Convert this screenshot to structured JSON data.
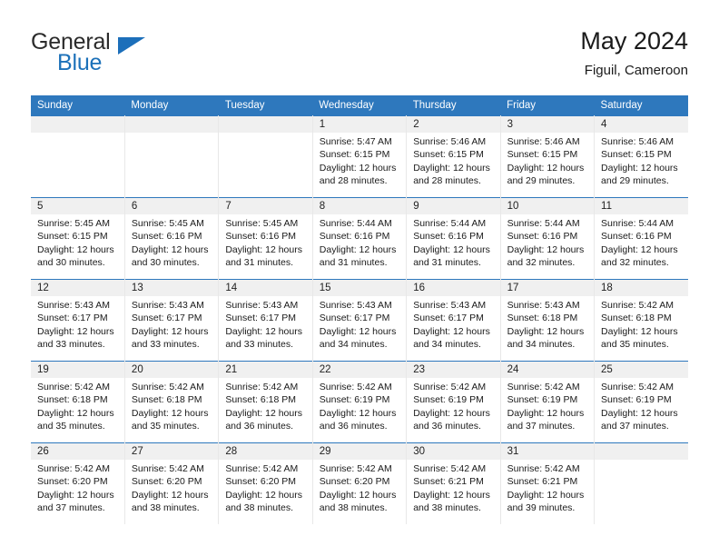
{
  "brand": {
    "word1": "General",
    "word2": "Blue",
    "accent_color": "#1c6fba"
  },
  "header": {
    "title": "May 2024",
    "location": "Figuil, Cameroon"
  },
  "calendar": {
    "header_bg": "#2e78bd",
    "daynum_bg": "#f0f0f0",
    "weekdays": [
      "Sunday",
      "Monday",
      "Tuesday",
      "Wednesday",
      "Thursday",
      "Friday",
      "Saturday"
    ],
    "weeks": [
      [
        {
          "day": "",
          "empty": true
        },
        {
          "day": "",
          "empty": true
        },
        {
          "day": "",
          "empty": true
        },
        {
          "day": "1",
          "sunrise": "Sunrise: 5:47 AM",
          "sunset": "Sunset: 6:15 PM",
          "daylight1": "Daylight: 12 hours",
          "daylight2": "and 28 minutes."
        },
        {
          "day": "2",
          "sunrise": "Sunrise: 5:46 AM",
          "sunset": "Sunset: 6:15 PM",
          "daylight1": "Daylight: 12 hours",
          "daylight2": "and 28 minutes."
        },
        {
          "day": "3",
          "sunrise": "Sunrise: 5:46 AM",
          "sunset": "Sunset: 6:15 PM",
          "daylight1": "Daylight: 12 hours",
          "daylight2": "and 29 minutes."
        },
        {
          "day": "4",
          "sunrise": "Sunrise: 5:46 AM",
          "sunset": "Sunset: 6:15 PM",
          "daylight1": "Daylight: 12 hours",
          "daylight2": "and 29 minutes."
        }
      ],
      [
        {
          "day": "5",
          "sunrise": "Sunrise: 5:45 AM",
          "sunset": "Sunset: 6:15 PM",
          "daylight1": "Daylight: 12 hours",
          "daylight2": "and 30 minutes."
        },
        {
          "day": "6",
          "sunrise": "Sunrise: 5:45 AM",
          "sunset": "Sunset: 6:16 PM",
          "daylight1": "Daylight: 12 hours",
          "daylight2": "and 30 minutes."
        },
        {
          "day": "7",
          "sunrise": "Sunrise: 5:45 AM",
          "sunset": "Sunset: 6:16 PM",
          "daylight1": "Daylight: 12 hours",
          "daylight2": "and 31 minutes."
        },
        {
          "day": "8",
          "sunrise": "Sunrise: 5:44 AM",
          "sunset": "Sunset: 6:16 PM",
          "daylight1": "Daylight: 12 hours",
          "daylight2": "and 31 minutes."
        },
        {
          "day": "9",
          "sunrise": "Sunrise: 5:44 AM",
          "sunset": "Sunset: 6:16 PM",
          "daylight1": "Daylight: 12 hours",
          "daylight2": "and 31 minutes."
        },
        {
          "day": "10",
          "sunrise": "Sunrise: 5:44 AM",
          "sunset": "Sunset: 6:16 PM",
          "daylight1": "Daylight: 12 hours",
          "daylight2": "and 32 minutes."
        },
        {
          "day": "11",
          "sunrise": "Sunrise: 5:44 AM",
          "sunset": "Sunset: 6:16 PM",
          "daylight1": "Daylight: 12 hours",
          "daylight2": "and 32 minutes."
        }
      ],
      [
        {
          "day": "12",
          "sunrise": "Sunrise: 5:43 AM",
          "sunset": "Sunset: 6:17 PM",
          "daylight1": "Daylight: 12 hours",
          "daylight2": "and 33 minutes."
        },
        {
          "day": "13",
          "sunrise": "Sunrise: 5:43 AM",
          "sunset": "Sunset: 6:17 PM",
          "daylight1": "Daylight: 12 hours",
          "daylight2": "and 33 minutes."
        },
        {
          "day": "14",
          "sunrise": "Sunrise: 5:43 AM",
          "sunset": "Sunset: 6:17 PM",
          "daylight1": "Daylight: 12 hours",
          "daylight2": "and 33 minutes."
        },
        {
          "day": "15",
          "sunrise": "Sunrise: 5:43 AM",
          "sunset": "Sunset: 6:17 PM",
          "daylight1": "Daylight: 12 hours",
          "daylight2": "and 34 minutes."
        },
        {
          "day": "16",
          "sunrise": "Sunrise: 5:43 AM",
          "sunset": "Sunset: 6:17 PM",
          "daylight1": "Daylight: 12 hours",
          "daylight2": "and 34 minutes."
        },
        {
          "day": "17",
          "sunrise": "Sunrise: 5:43 AM",
          "sunset": "Sunset: 6:18 PM",
          "daylight1": "Daylight: 12 hours",
          "daylight2": "and 34 minutes."
        },
        {
          "day": "18",
          "sunrise": "Sunrise: 5:42 AM",
          "sunset": "Sunset: 6:18 PM",
          "daylight1": "Daylight: 12 hours",
          "daylight2": "and 35 minutes."
        }
      ],
      [
        {
          "day": "19",
          "sunrise": "Sunrise: 5:42 AM",
          "sunset": "Sunset: 6:18 PM",
          "daylight1": "Daylight: 12 hours",
          "daylight2": "and 35 minutes."
        },
        {
          "day": "20",
          "sunrise": "Sunrise: 5:42 AM",
          "sunset": "Sunset: 6:18 PM",
          "daylight1": "Daylight: 12 hours",
          "daylight2": "and 35 minutes."
        },
        {
          "day": "21",
          "sunrise": "Sunrise: 5:42 AM",
          "sunset": "Sunset: 6:18 PM",
          "daylight1": "Daylight: 12 hours",
          "daylight2": "and 36 minutes."
        },
        {
          "day": "22",
          "sunrise": "Sunrise: 5:42 AM",
          "sunset": "Sunset: 6:19 PM",
          "daylight1": "Daylight: 12 hours",
          "daylight2": "and 36 minutes."
        },
        {
          "day": "23",
          "sunrise": "Sunrise: 5:42 AM",
          "sunset": "Sunset: 6:19 PM",
          "daylight1": "Daylight: 12 hours",
          "daylight2": "and 36 minutes."
        },
        {
          "day": "24",
          "sunrise": "Sunrise: 5:42 AM",
          "sunset": "Sunset: 6:19 PM",
          "daylight1": "Daylight: 12 hours",
          "daylight2": "and 37 minutes."
        },
        {
          "day": "25",
          "sunrise": "Sunrise: 5:42 AM",
          "sunset": "Sunset: 6:19 PM",
          "daylight1": "Daylight: 12 hours",
          "daylight2": "and 37 minutes."
        }
      ],
      [
        {
          "day": "26",
          "sunrise": "Sunrise: 5:42 AM",
          "sunset": "Sunset: 6:20 PM",
          "daylight1": "Daylight: 12 hours",
          "daylight2": "and 37 minutes."
        },
        {
          "day": "27",
          "sunrise": "Sunrise: 5:42 AM",
          "sunset": "Sunset: 6:20 PM",
          "daylight1": "Daylight: 12 hours",
          "daylight2": "and 38 minutes."
        },
        {
          "day": "28",
          "sunrise": "Sunrise: 5:42 AM",
          "sunset": "Sunset: 6:20 PM",
          "daylight1": "Daylight: 12 hours",
          "daylight2": "and 38 minutes."
        },
        {
          "day": "29",
          "sunrise": "Sunrise: 5:42 AM",
          "sunset": "Sunset: 6:20 PM",
          "daylight1": "Daylight: 12 hours",
          "daylight2": "and 38 minutes."
        },
        {
          "day": "30",
          "sunrise": "Sunrise: 5:42 AM",
          "sunset": "Sunset: 6:21 PM",
          "daylight1": "Daylight: 12 hours",
          "daylight2": "and 38 minutes."
        },
        {
          "day": "31",
          "sunrise": "Sunrise: 5:42 AM",
          "sunset": "Sunset: 6:21 PM",
          "daylight1": "Daylight: 12 hours",
          "daylight2": "and 39 minutes."
        },
        {
          "day": "",
          "empty": true
        }
      ]
    ]
  }
}
